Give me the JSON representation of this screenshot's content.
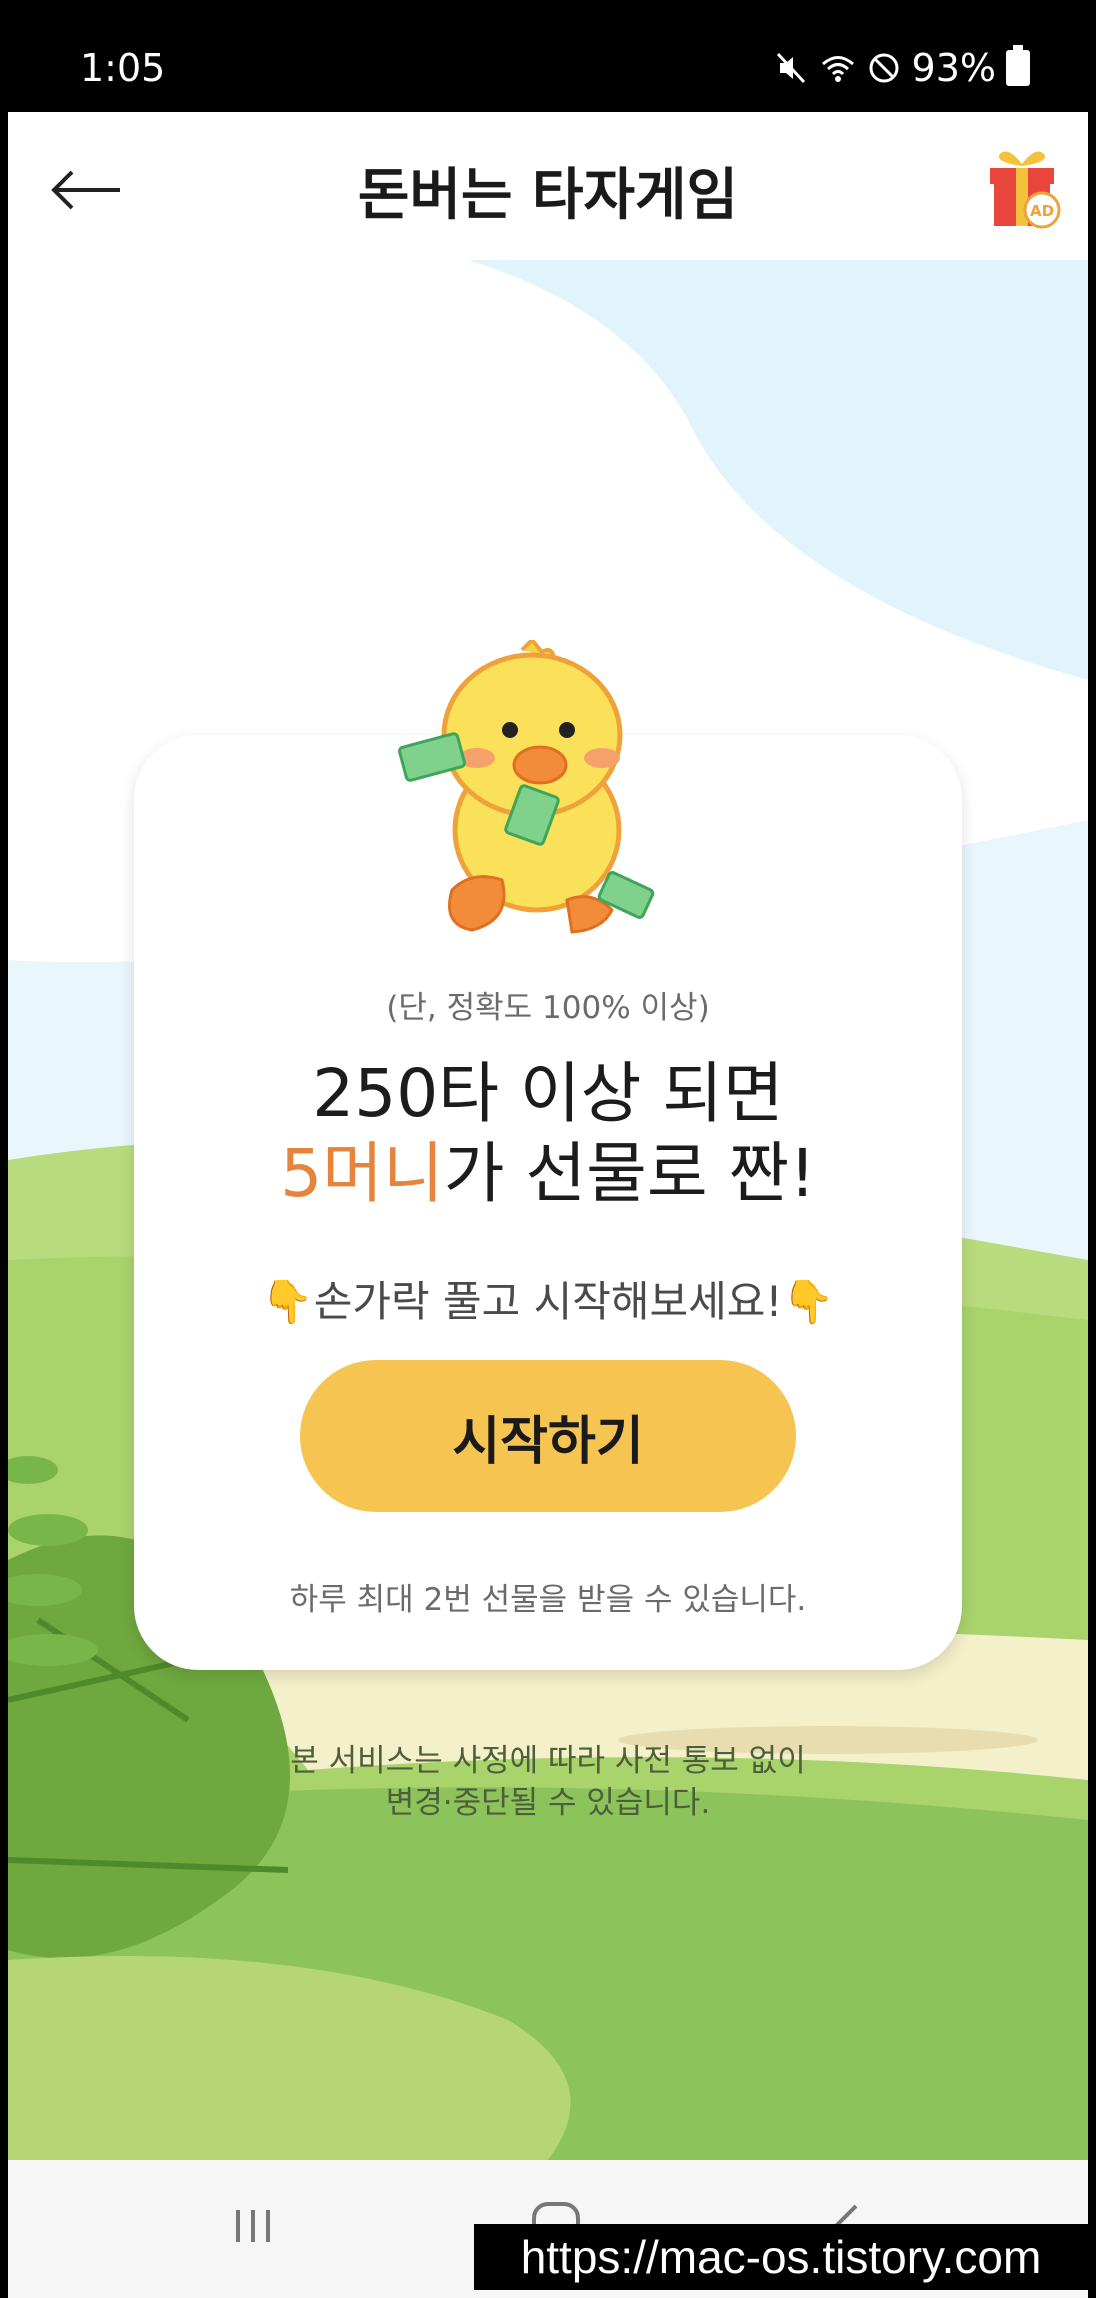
{
  "status_bar": {
    "time": "1:05",
    "battery": "93%"
  },
  "header": {
    "title": "돈버는 타자게임",
    "back_icon": "arrow-left-icon",
    "gift_icon": "gift-ad-icon",
    "gift_badge": "AD"
  },
  "card": {
    "note": "(단, 정확도 100% 이상)",
    "line1": "250타 이상 되면",
    "line2_accent": "5머니",
    "line2_rest": "가 선물로 짠!",
    "hint": "👇손가락 풀고 시작해보세요!👇",
    "start_button": "시작하기",
    "limit": "하루 최대 2번 선물을 받을 수 있습니다."
  },
  "notice": {
    "line1": "본 서비스는 사정에 따라 사전 통보 없이",
    "line2": "변경·중단될 수 있습니다."
  },
  "nav": {
    "recent_icon": "recent-apps-icon",
    "home_icon": "home-icon",
    "back_icon": "nav-back-icon"
  },
  "watermark": "https://mac-os.tistory.com",
  "colors": {
    "accent": "#e5843a",
    "button": "#f5c451",
    "sky": "#dff3fa",
    "grass": "#8cc35a"
  }
}
